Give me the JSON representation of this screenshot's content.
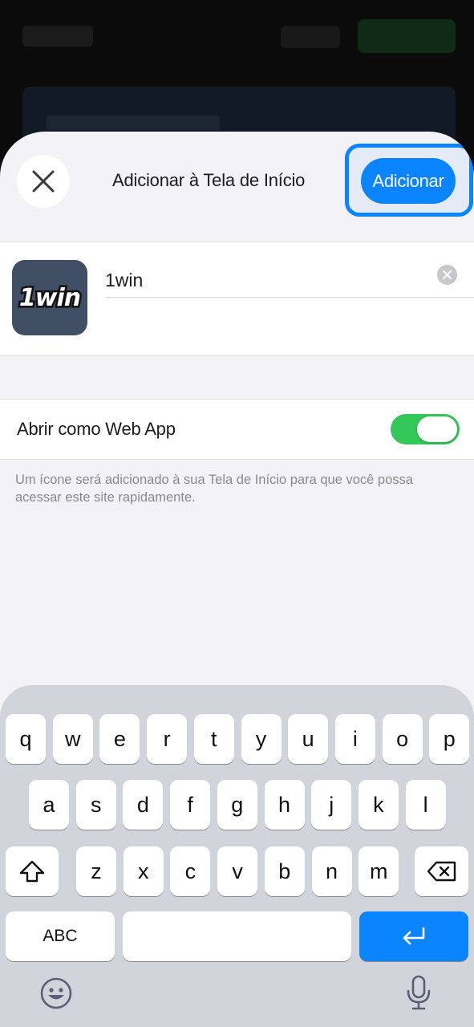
{
  "sheet": {
    "title": "Adicionar à Tela de Início",
    "add_label": "Adicionar"
  },
  "app": {
    "icon_text": "1win",
    "name_value": "1win"
  },
  "web_app": {
    "label": "Abrir como Web App",
    "enabled": true
  },
  "footnote": "Um ícone será adicionado à sua Tela de Início para que você possa acessar este site rapidamente.",
  "keyboard": {
    "row1": [
      "q",
      "w",
      "e",
      "r",
      "t",
      "y",
      "u",
      "i",
      "o",
      "p"
    ],
    "row2": [
      "a",
      "s",
      "d",
      "f",
      "g",
      "h",
      "j",
      "k",
      "l"
    ],
    "row3": [
      "z",
      "x",
      "c",
      "v",
      "b",
      "n",
      "m"
    ],
    "abc_label": "ABC",
    "icons": {
      "shift": "shift-icon",
      "delete": "delete-icon",
      "return": "return-icon",
      "emoji": "emoji-icon",
      "mic": "microphone-icon"
    }
  },
  "colors": {
    "accent": "#0a84ff",
    "toggle_on": "#34c759",
    "sheet_bg": "#f2f2f7",
    "keyboard_bg": "#d2d4db"
  }
}
